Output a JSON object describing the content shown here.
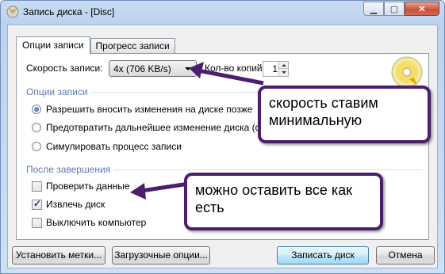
{
  "window": {
    "title": "Запись диска - [Disc]",
    "icons": {
      "app": "disc-burn-icon",
      "minimize": "minimize-icon",
      "maximize": "maximize-icon",
      "close": "close-icon"
    }
  },
  "tabs": [
    {
      "label": "Опции записи",
      "active": true
    },
    {
      "label": "Прогресс записи",
      "active": false
    }
  ],
  "speed": {
    "label": "Скорость записи:",
    "value": "4x (706 KB/s)"
  },
  "copies": {
    "label": "Кол-во копий:",
    "value": "1"
  },
  "write_options": {
    "title": "Опции записи",
    "radios": [
      {
        "label": "Разрешить вносить изменения на диске позже",
        "checked": true
      },
      {
        "label": "Предотвратить дальнейшее изменение диска (фина",
        "checked": false
      },
      {
        "label": "Симулировать процесс записи",
        "checked": false
      }
    ]
  },
  "after": {
    "title": "После завершения",
    "checks": [
      {
        "label": "Проверить данные",
        "checked": false
      },
      {
        "label": "Извлечь диск",
        "checked": true
      },
      {
        "label": "Выключить компьютер",
        "checked": false
      }
    ]
  },
  "buttons": {
    "labels": "Установить метки...",
    "boot": "Загрузочные опции...",
    "burn": "Записать диск",
    "cancel": "Отмена"
  },
  "annotations": {
    "speed_note": "скорость ставим минимальную",
    "options_note": "можно оставить все как есть",
    "color": "#4b1f6e"
  },
  "colors": {
    "group_title": "#5a7ab0",
    "close_button": "#c7503a"
  }
}
